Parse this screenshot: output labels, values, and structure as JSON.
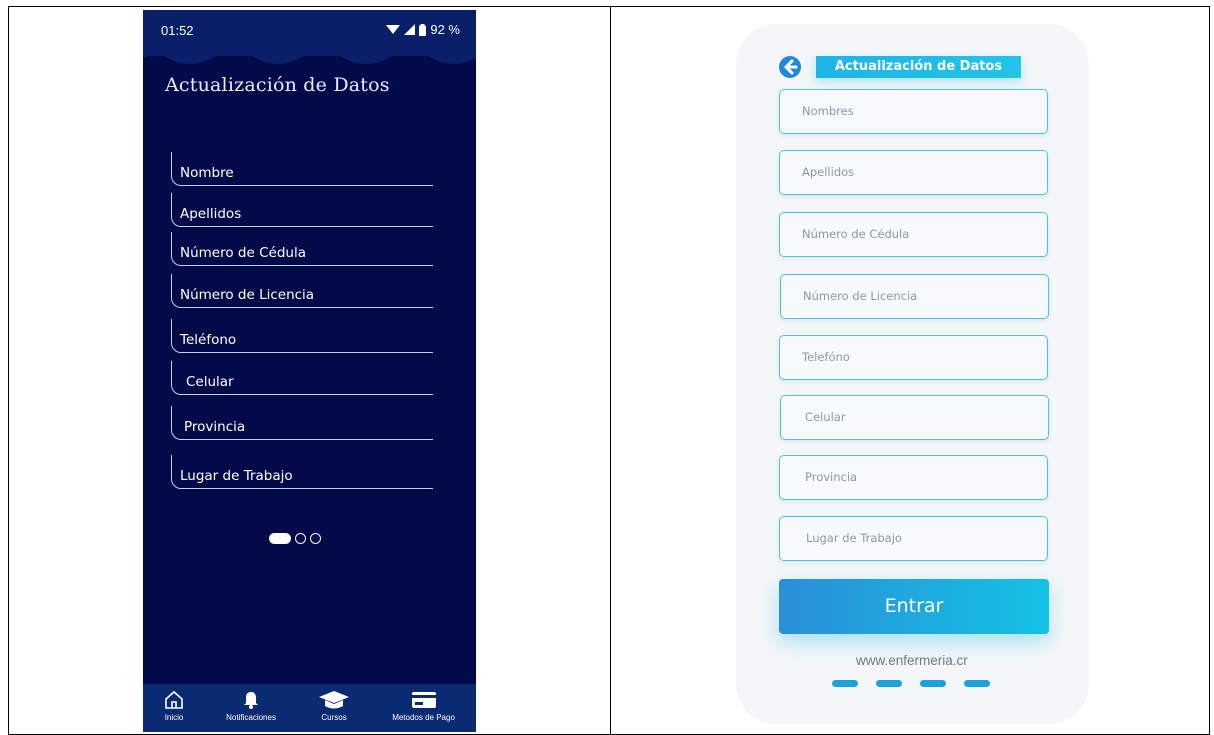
{
  "left_phone": {
    "status": {
      "time": "01:52",
      "battery": "92 %"
    },
    "title": "Actualización de Datos",
    "fields": [
      "Nombre",
      "Apellidos",
      "Número de Cédula",
      "Número de Licencia",
      "Teléfono",
      "Celular",
      "Provincia",
      "Lugar de Trabajo"
    ],
    "pager": {
      "count": 3,
      "active": 0
    },
    "nav": {
      "inicio": "Inicio",
      "notificaciones": "Notificaciones",
      "cursos": "Cursos",
      "pagos": "Metodos de Pago"
    }
  },
  "right_phone": {
    "title": "Actualización de Datos",
    "fields": [
      "Nombres",
      "Apellidos",
      "Número de Cédula",
      "Número de Licencia",
      "Telefóno",
      "Celular",
      "Provincia",
      "Lugar de Trabajo"
    ],
    "submit_label": "Entrar",
    "website": "www.enfermeria.cr",
    "pager": {
      "count": 4
    }
  },
  "colors": {
    "left_bg": "#030a4a",
    "left_nav_bg": "#0a2a72",
    "right_accent": "#1fb4e8",
    "right_field_border": "#4cc0e2"
  },
  "icons": [
    "wifi-icon",
    "signal-icon",
    "battery-icon",
    "home-icon",
    "bell-icon",
    "graduation-cap-icon",
    "credit-card-icon",
    "back-arrow-icon"
  ]
}
